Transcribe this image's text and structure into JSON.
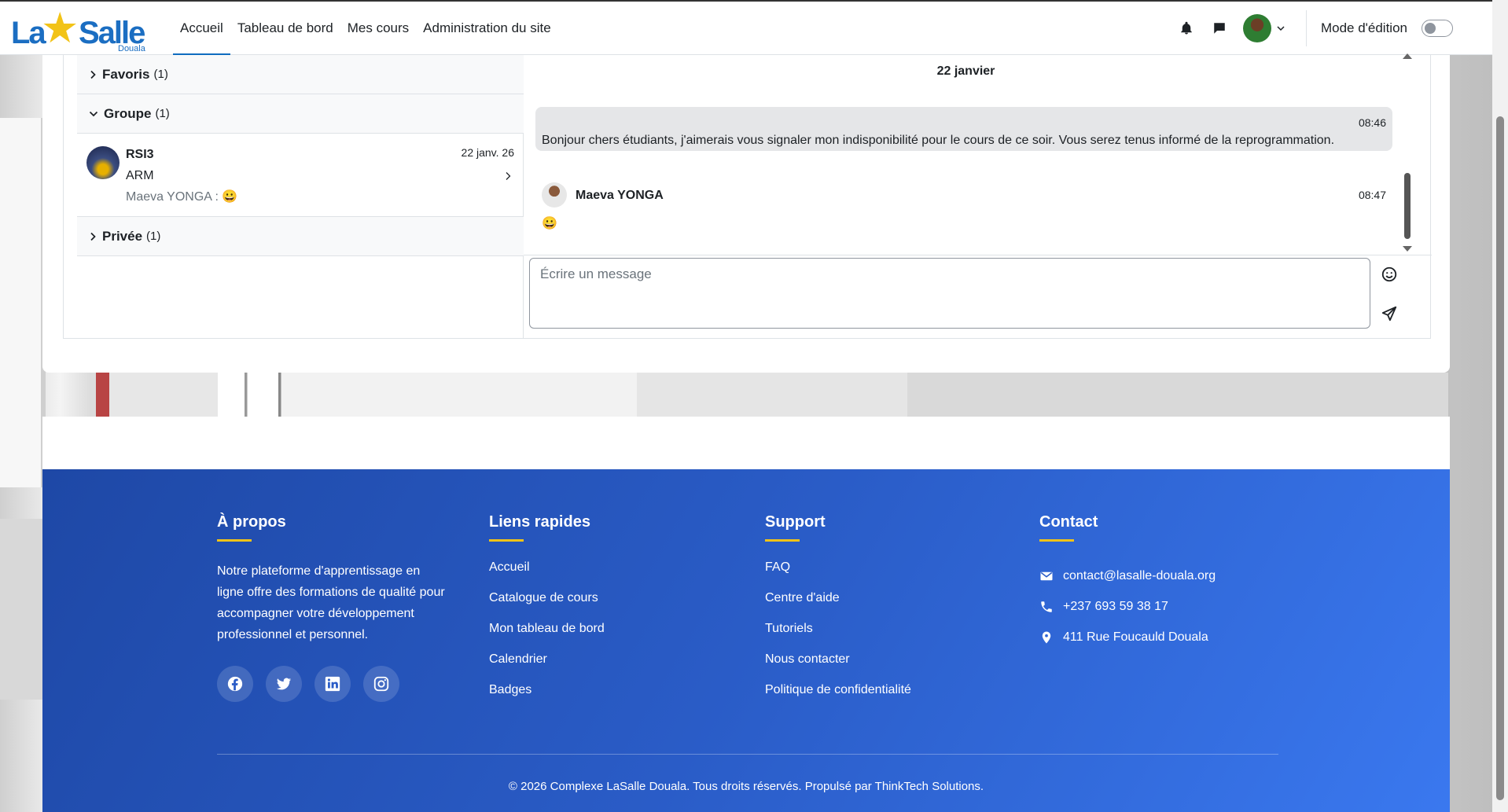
{
  "logo": {
    "part1": "La",
    "part2": "Salle",
    "city": "Douala"
  },
  "nav": {
    "links": [
      {
        "label": "Accueil",
        "active": true
      },
      {
        "label": "Tableau de bord",
        "active": false
      },
      {
        "label": "Mes cours",
        "active": false
      },
      {
        "label": "Administration du site",
        "active": false
      }
    ],
    "edit_mode_label": "Mode d'édition"
  },
  "sidebar": {
    "favorites": {
      "label": "Favoris",
      "count": "(1)"
    },
    "group": {
      "label": "Groupe",
      "count": "(1)"
    },
    "conversation": {
      "name": "RSI3",
      "subtitle": "ARM",
      "last_message": "Maeva YONGA : 😀",
      "date": "22 janv. 26"
    },
    "private": {
      "label": "Privée",
      "count": "(1)"
    }
  },
  "chat": {
    "day_label": "22 janvier",
    "messages": [
      {
        "time": "08:46",
        "text": "Bonjour chers étudiants, j'aimerais vous signaler mon indisponibilité pour le cours de ce soir. Vous serez tenus informé de la reprogrammation."
      },
      {
        "author": "Maeva YONGA",
        "time": "08:47",
        "text": "😀"
      }
    ],
    "compose_placeholder": "Écrire un message"
  },
  "footer": {
    "about": {
      "title": "À propos",
      "text": "Notre plateforme d'apprentissage en ligne offre des formations de qualité pour accompagner votre développement professionnel et personnel."
    },
    "quick_links": {
      "title": "Liens rapides",
      "items": [
        "Accueil",
        "Catalogue de cours",
        "Mon tableau de bord",
        "Calendrier",
        "Badges"
      ]
    },
    "support": {
      "title": "Support",
      "items": [
        "FAQ",
        "Centre d'aide",
        "Tutoriels",
        "Nous contacter",
        "Politique de confidentialité"
      ]
    },
    "contact": {
      "title": "Contact",
      "email": "contact@lasalle-douala.org",
      "phone": "+237 693 59 38 17",
      "address": "411 Rue Foucauld Douala"
    },
    "copyright": "© 2026 Complexe LaSalle Douala. Tous droits réservés. Propulsé par ThinkTech Solutions."
  },
  "colors": {
    "accent": "#0f6cbf",
    "footer_accent": "#f2c317",
    "footer_bg": "#2a5cc7"
  }
}
